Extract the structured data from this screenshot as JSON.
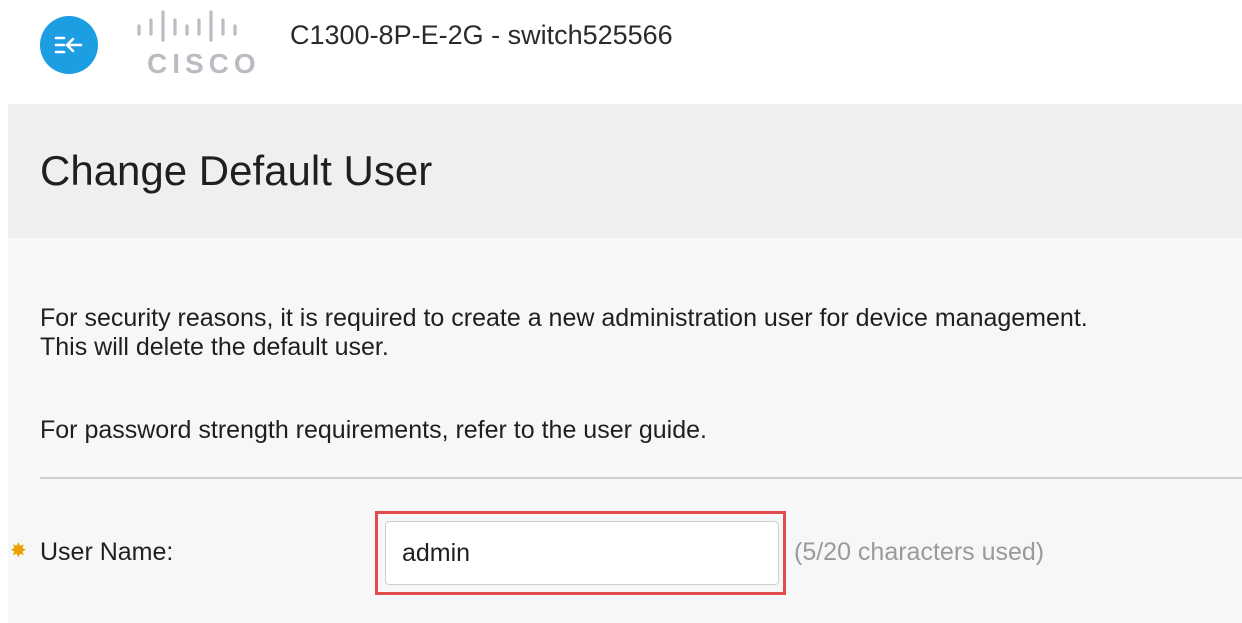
{
  "header": {
    "logo_text": "CISCO",
    "device_title": "C1300-8P-E-2G - switch525566"
  },
  "page": {
    "title": "Change Default User"
  },
  "content": {
    "notice_line1": "For security reasons, it is required to create a new administration user for device management.",
    "notice_line2": "This will delete the default user.",
    "password_note": "For password strength requirements, refer to the user guide."
  },
  "form": {
    "username": {
      "label": "User Name:",
      "value": "admin",
      "char_count": "(5/20 characters used)"
    }
  },
  "icons": {
    "back": "back-arrow-icon",
    "required": "required-asterisk-icon"
  },
  "colors": {
    "accent": "#1b9ee2",
    "highlight": "#e04b4b",
    "required": "#e8a100"
  }
}
